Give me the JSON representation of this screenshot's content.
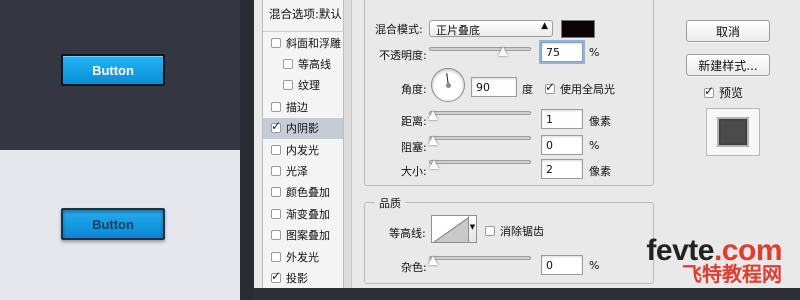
{
  "preview": {
    "dark_button_label": "Button",
    "light_button_label": "Button"
  },
  "style_list": {
    "header": "混合选项:默认",
    "items": [
      {
        "label": "斜面和浮雕",
        "checked": false,
        "indent": false,
        "selected": false
      },
      {
        "label": "等高线",
        "checked": false,
        "indent": true,
        "selected": false
      },
      {
        "label": "纹理",
        "checked": false,
        "indent": true,
        "selected": false
      },
      {
        "label": "描边",
        "checked": false,
        "indent": false,
        "selected": false
      },
      {
        "label": "内阴影",
        "checked": true,
        "indent": false,
        "selected": true
      },
      {
        "label": "内发光",
        "checked": false,
        "indent": false,
        "selected": false
      },
      {
        "label": "光泽",
        "checked": false,
        "indent": false,
        "selected": false
      },
      {
        "label": "颜色叠加",
        "checked": false,
        "indent": false,
        "selected": false
      },
      {
        "label": "渐变叠加",
        "checked": false,
        "indent": false,
        "selected": false
      },
      {
        "label": "图案叠加",
        "checked": false,
        "indent": false,
        "selected": false
      },
      {
        "label": "外发光",
        "checked": false,
        "indent": false,
        "selected": false
      },
      {
        "label": "投影",
        "checked": true,
        "indent": false,
        "selected": false
      }
    ]
  },
  "structure": {
    "blend_mode_label": "混合模式:",
    "blend_mode_value": "正片叠底",
    "shadow_color": "#0b0406",
    "opacity_label": "不透明度:",
    "opacity_value": "75",
    "opacity_unit": "%",
    "opacity_fraction": 0.75,
    "angle_label": "角度:",
    "angle_value": "90",
    "angle_unit": "度",
    "global_light_label": "使用全局光",
    "global_light_checked": true,
    "distance_label": "距离:",
    "distance_value": "1",
    "distance_unit": "像素",
    "choke_label": "阻塞:",
    "choke_value": "0",
    "choke_unit": "%",
    "size_label": "大小:",
    "size_value": "2",
    "size_unit": "像素"
  },
  "quality": {
    "title": "品质",
    "contour_label": "等高线:",
    "anti_alias_label": "消除锯齿",
    "anti_alias_checked": false,
    "noise_label": "杂色:",
    "noise_value": "0",
    "noise_unit": "%"
  },
  "actions": {
    "cancel": "取消",
    "new_style": "新建样式...",
    "preview_label": "预览",
    "preview_checked": true
  },
  "watermark": {
    "site_prefix": "fevte",
    "site_suffix": ".com",
    "site_cn": "飞特教程网"
  }
}
